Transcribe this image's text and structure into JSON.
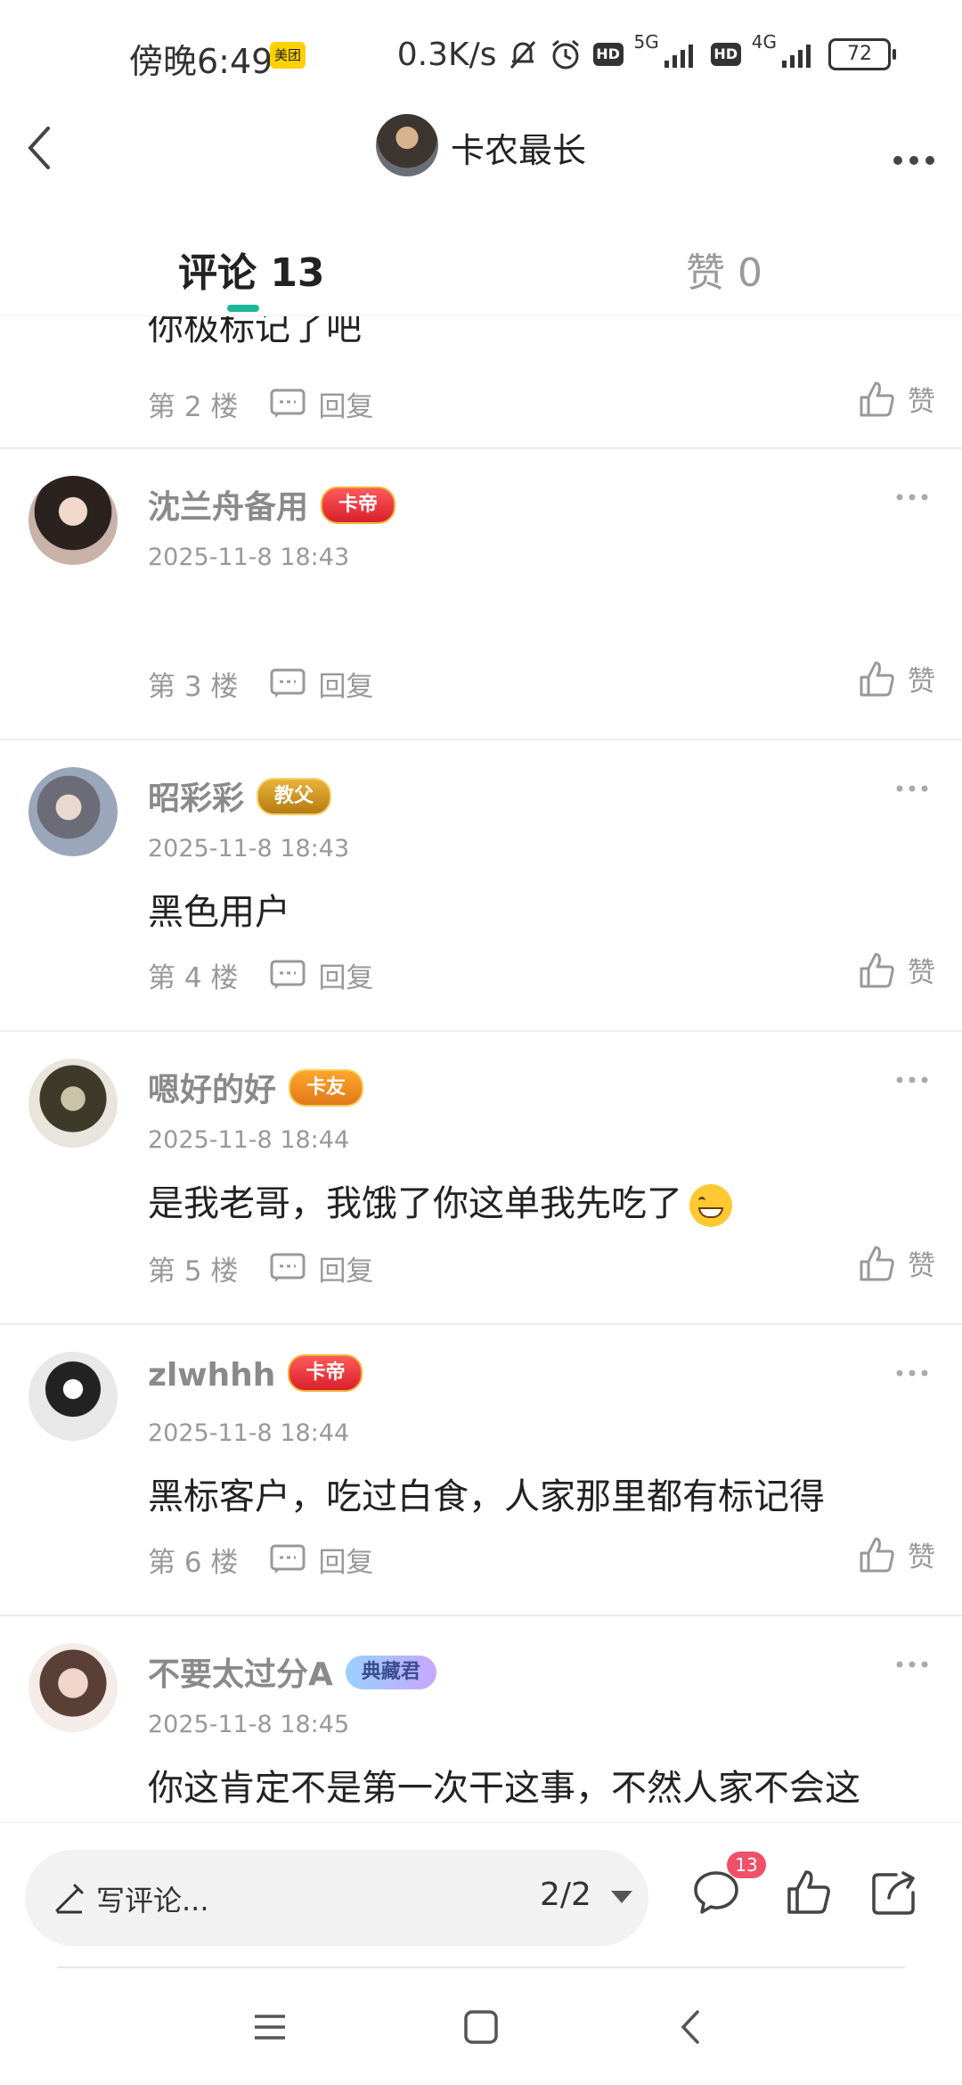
{
  "status_bar": {
    "time": "傍晚6:49",
    "app_badge": "美团",
    "net_speed": "0.3K/s",
    "hd1": "HD",
    "sig1": "5G",
    "hd2": "HD",
    "sig2": "4G",
    "battery": "72"
  },
  "header": {
    "title": "卡农最长"
  },
  "tabs": {
    "comments": "评论 13",
    "likes": "赞 0"
  },
  "comments": [
    {
      "content": "你极标记了吧",
      "floor": "第 2 楼",
      "reply": "回复",
      "like": "赞"
    },
    {
      "name": "沈兰舟备用",
      "badge": "卡帝",
      "date": "2025-11-8 18:43",
      "content": "",
      "floor": "第 3 楼",
      "reply": "回复",
      "like": "赞"
    },
    {
      "name": "昭彩彩",
      "badge": "教父",
      "date": "2025-11-8 18:43",
      "content": "黑色用户",
      "floor": "第 4 楼",
      "reply": "回复",
      "like": "赞"
    },
    {
      "name": "嗯好的好",
      "badge": "卡友",
      "date": "2025-11-8 18:44",
      "content": "是我老哥，我饿了你这单我先吃了",
      "floor": "第 5 楼",
      "reply": "回复",
      "like": "赞"
    },
    {
      "name": "zlwhhh",
      "badge": "卡帝",
      "date": "2025-11-8 18:44",
      "content": "黑标客户，吃过白食，人家那里都有标记得",
      "floor": "第 6 楼",
      "reply": "回复",
      "like": "赞"
    },
    {
      "name": "不要太过分A",
      "badge": "典藏君",
      "date": "2025-11-8 18:45",
      "content": "你这肯定不是第一次干这事，不然人家不会这"
    }
  ],
  "bottom_bar": {
    "compose_placeholder": "写评论...",
    "page_indicator": "2/2",
    "comment_count": "13"
  },
  "colors": {
    "accent": "#1bb99a",
    "badge_red": "#f0506a"
  }
}
